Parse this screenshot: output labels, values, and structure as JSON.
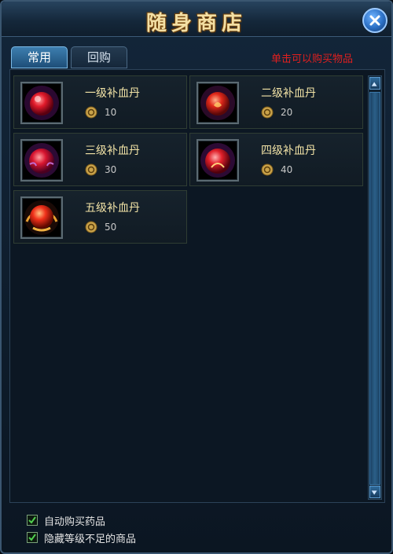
{
  "window": {
    "title": "随身商店"
  },
  "tabs": [
    {
      "label": "常用",
      "active": true
    },
    {
      "label": "回购",
      "active": false
    }
  ],
  "hint": "单击可以购买物品",
  "items": [
    {
      "name": "一级补血丹",
      "price": "10",
      "icon": "red-orb-icon"
    },
    {
      "name": "二级补血丹",
      "price": "20",
      "icon": "red-orb-icon"
    },
    {
      "name": "三级补血丹",
      "price": "30",
      "icon": "red-orb-icon"
    },
    {
      "name": "四级补血丹",
      "price": "40",
      "icon": "red-orb-icon"
    },
    {
      "name": "五级补血丹",
      "price": "50",
      "icon": "red-orb-icon"
    }
  ],
  "options": [
    {
      "label": "自动购买药品",
      "checked": true
    },
    {
      "label": "隐藏等级不足的商品",
      "checked": true
    }
  ],
  "colors": {
    "title": "#f3dfa4",
    "hint": "#e01f1f",
    "item_name": "#f2e3a6"
  }
}
